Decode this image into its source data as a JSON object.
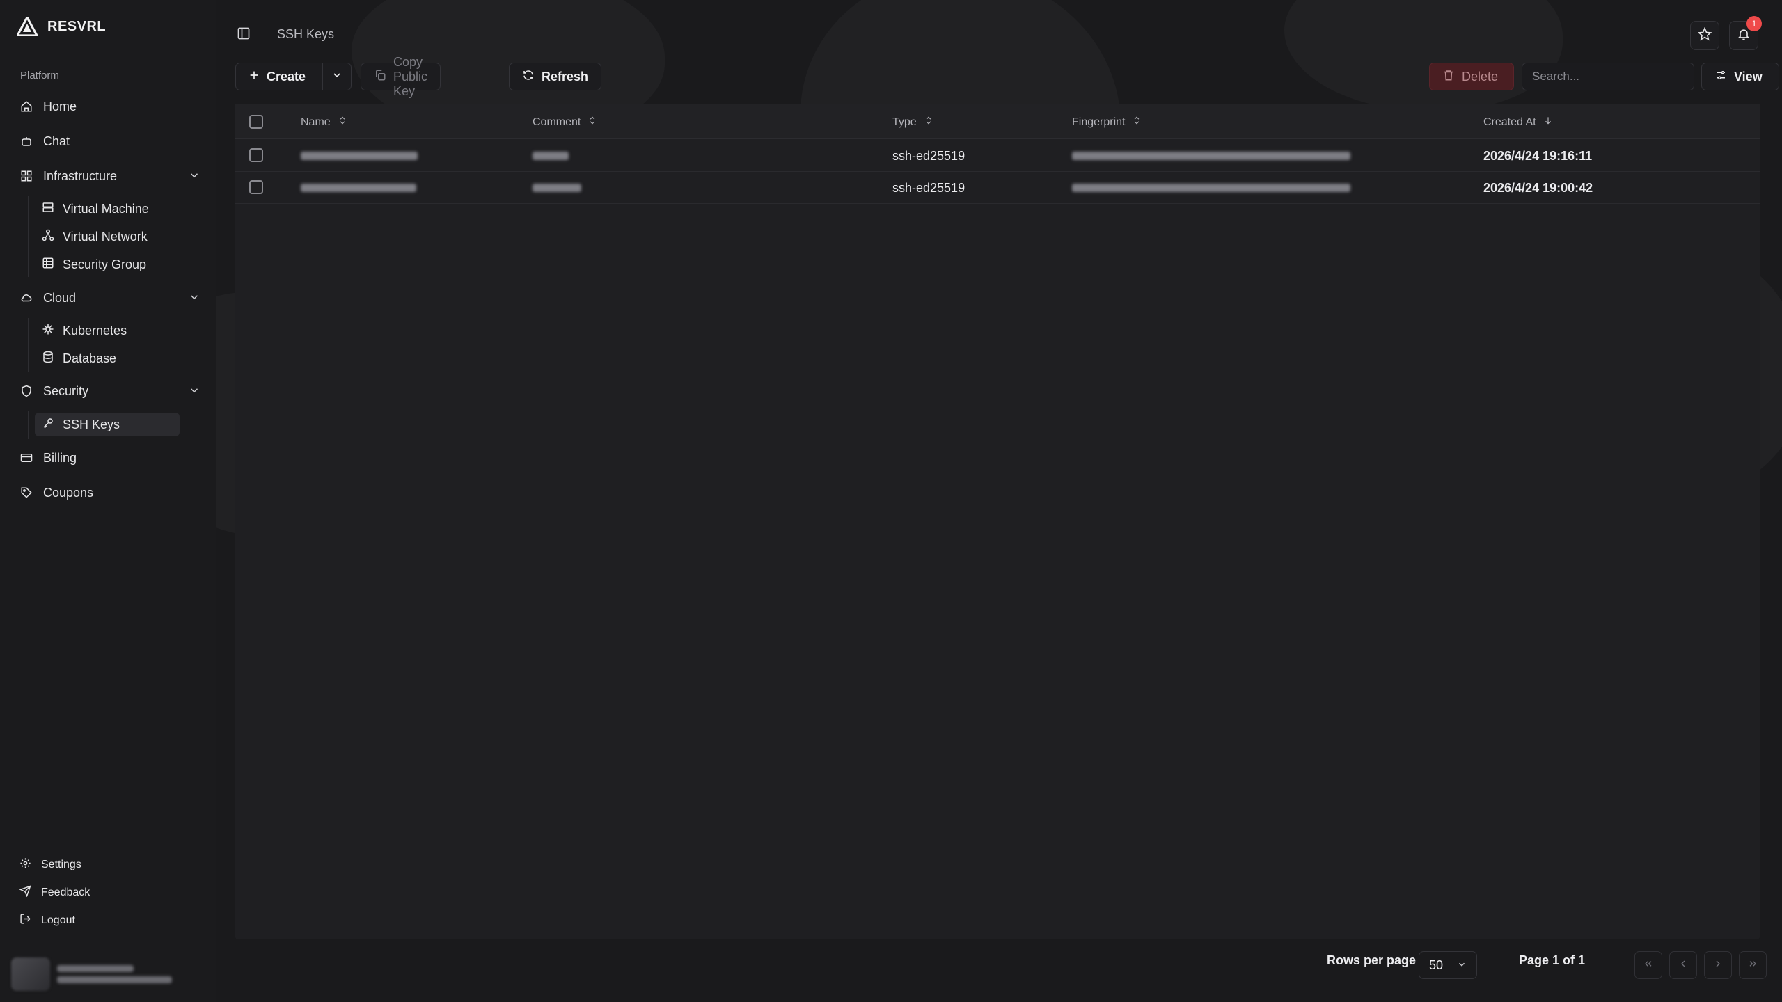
{
  "app": {
    "brand": "RESVRL"
  },
  "sidebar": {
    "group_label": "Platform",
    "items": {
      "home": "Home",
      "chat": "Chat",
      "infrastructure": "Infrastructure",
      "virtual_machine": "Virtual Machine",
      "virtual_network": "Virtual Network",
      "security_group": "Security Group",
      "cloud": "Cloud",
      "kubernetes": "Kubernetes",
      "database": "Database",
      "security": "Security",
      "ssh_keys": "SSH Keys",
      "billing": "Billing",
      "coupons": "Coupons"
    },
    "footer": {
      "settings": "Settings",
      "feedback": "Feedback",
      "logout": "Logout"
    }
  },
  "header": {
    "breadcrumb": "SSH Keys",
    "notification_count": "1"
  },
  "toolbar": {
    "create": "Create",
    "copy_public_key": "Copy Public Key",
    "refresh": "Refresh",
    "delete": "Delete",
    "search_placeholder": "Search...",
    "view": "View"
  },
  "table": {
    "columns": {
      "name": "Name",
      "comment": "Comment",
      "type": "Type",
      "fingerprint": "Fingerprint",
      "created_at": "Created At"
    },
    "rows": [
      {
        "type": "ssh-ed25519",
        "created_at": "2026/4/24 19:16:11"
      },
      {
        "type": "ssh-ed25519",
        "created_at": "2026/4/24 19:00:42"
      }
    ]
  },
  "pagination": {
    "rows_per_page_label": "Rows per page",
    "rows_per_page": "50",
    "page_info": "Page 1 of 1"
  },
  "colors": {
    "accent_danger": "#ef4a4a",
    "background": "#1a1a1c"
  }
}
